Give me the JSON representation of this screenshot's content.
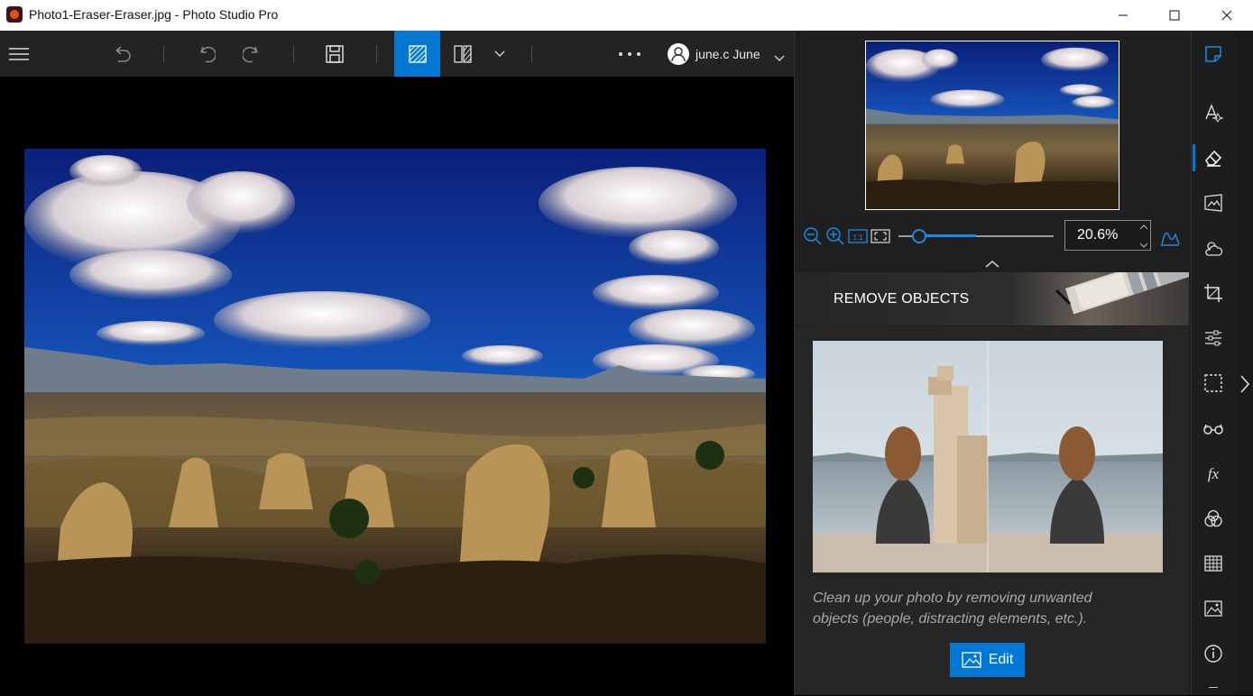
{
  "window": {
    "title": "Photo1-Eraser-Eraser.jpg - Photo Studio Pro",
    "buttons": [
      "minimize-icon",
      "maximize-icon",
      "close-icon"
    ]
  },
  "toolbar": {
    "user_name": "june.c June",
    "items": [
      "menu-icon",
      "undo-all-icon",
      "undo-icon",
      "redo-icon",
      "save-icon",
      "view-single-icon",
      "view-compare-icon",
      "view-dropdown-icon",
      "more-icon"
    ],
    "active_view": "single",
    "accent": "#0078d4"
  },
  "navigator": {
    "zoom_value": "20.6%",
    "zoom_level_percent": 20.6,
    "tools": [
      "zoom-out-icon",
      "zoom-in-icon",
      "actual-size-icon",
      "fit-icon",
      "histogram-icon"
    ]
  },
  "tool_panel": {
    "banner_title": "REMOVE OBJECTS",
    "description": "Clean up your photo by removing unwanted objects (people, distracting elements, etc.).",
    "edit_label": "Edit"
  },
  "sidebar": {
    "icons": [
      "edit-notes-icon",
      "auto-enhance-icon",
      "eraser-icon",
      "perspective-icon",
      "weather-icon",
      "crop-icon",
      "adjust-icon",
      "selection-icon",
      "glasses-icon",
      "fx-icon",
      "color-mix-icon",
      "texture-icon",
      "image-icon",
      "info-icon"
    ],
    "active": "eraser-icon"
  }
}
